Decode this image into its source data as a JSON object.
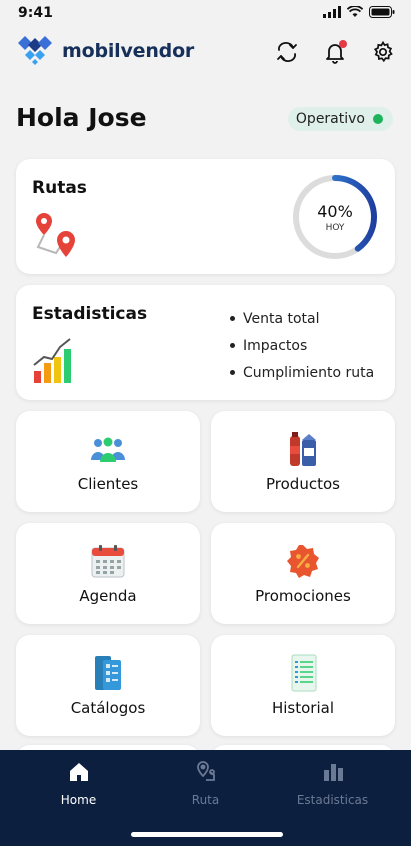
{
  "status_bar": {
    "time": "9:41"
  },
  "header": {
    "brand": "mobilvendor"
  },
  "greeting": {
    "text": "Hola Jose"
  },
  "status_badge": {
    "label": "Operativo",
    "color": "#1db35a"
  },
  "rutas_card": {
    "title": "Rutas",
    "progress_text": "40%",
    "progress_fraction": 0.4,
    "progress_sub": "HOY"
  },
  "stats_card": {
    "title": "Estadisticas",
    "items": [
      "Venta total",
      "Impactos",
      "Cumplimiento ruta"
    ]
  },
  "tiles": [
    {
      "label": "Clientes",
      "icon": "people-icon"
    },
    {
      "label": "Productos",
      "icon": "products-icon"
    },
    {
      "label": "Agenda",
      "icon": "calendar-icon"
    },
    {
      "label": "Promociones",
      "icon": "discount-badge-icon"
    },
    {
      "label": "Catálogos",
      "icon": "catalog-icon"
    },
    {
      "label": "Historial",
      "icon": "history-list-icon"
    }
  ],
  "bottom_nav": [
    {
      "label": "Home",
      "icon": "home-icon",
      "active": true
    },
    {
      "label": "Ruta",
      "icon": "route-pin-icon",
      "active": false
    },
    {
      "label": "Estadisticas",
      "icon": "bar-chart-icon",
      "active": false
    }
  ],
  "colors": {
    "nav_bg": "#0c1f3f",
    "brand": "#17305a",
    "progress_start": "#3ca0f0",
    "progress_end": "#1f3fa0",
    "badge_bg": "#dff0ea"
  }
}
